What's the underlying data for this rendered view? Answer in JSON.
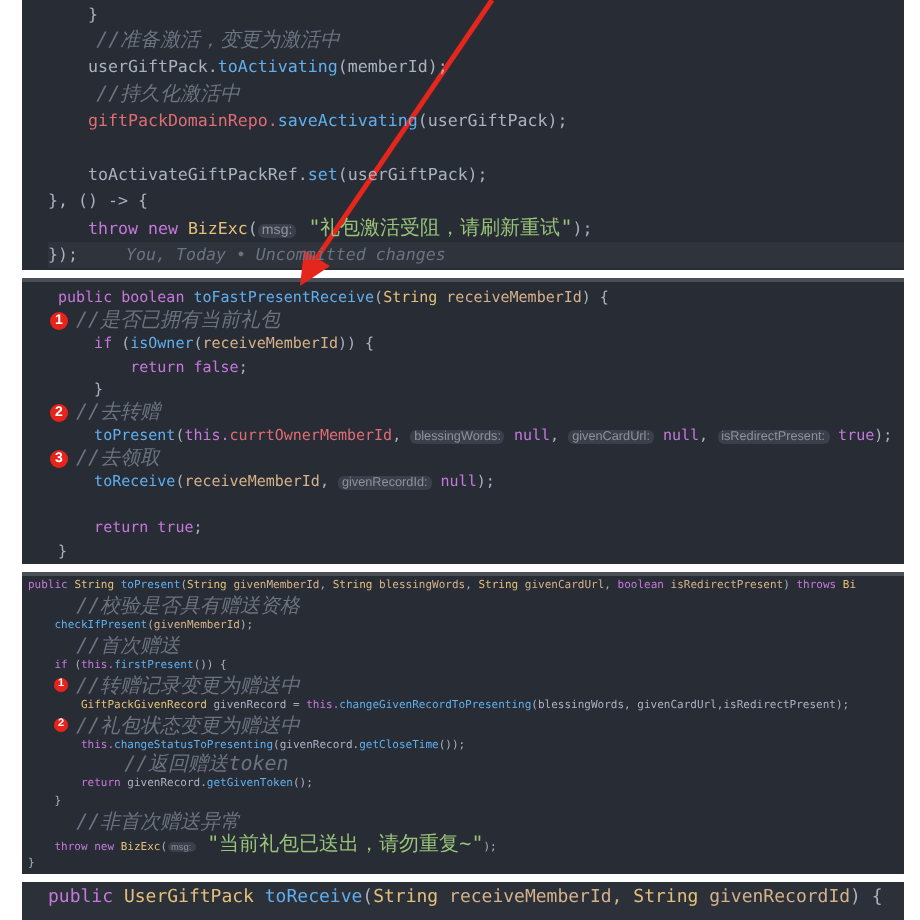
{
  "panels": [
    {
      "lines": [
        {
          "tokens": [
            {
              "kind": "plain",
              "text": "    }"
            }
          ]
        },
        {
          "tokens": [
            {
              "kind": "comment",
              "text": "    //准备激活，变更为激活中"
            }
          ]
        },
        {
          "tokens": [
            {
              "kind": "plain",
              "text": "    userGiftPack."
            },
            {
              "kind": "fn",
              "text": "toActivating"
            },
            {
              "kind": "plain",
              "text": "(memberId);"
            }
          ]
        },
        {
          "tokens": [
            {
              "kind": "comment",
              "text": "    //持久化激活中"
            }
          ]
        },
        {
          "tokens": [
            {
              "kind": "field",
              "text": "    giftPackDomainRepo."
            },
            {
              "kind": "fn",
              "text": "saveActivating"
            },
            {
              "kind": "plain",
              "text": "(userGiftPack);"
            }
          ]
        },
        {
          "space_before": true,
          "tokens": [
            {
              "kind": "plain",
              "text": "    toActivateGiftPackRef."
            },
            {
              "kind": "fn",
              "text": "set"
            },
            {
              "kind": "plain",
              "text": "(userGiftPack);"
            }
          ]
        },
        {
          "tokens": [
            {
              "kind": "plain",
              "text": "}, () -> {"
            }
          ]
        },
        {
          "tokens": [
            {
              "kind": "kw",
              "text": "    throw new "
            },
            {
              "kind": "type",
              "text": "BizExc"
            },
            {
              "kind": "plain",
              "text": "("
            },
            {
              "kind": "hint",
              "text": "msg:"
            },
            {
              "kind": "str",
              "text": " \"礼包激活受阻，请刷新重试\""
            },
            {
              "kind": "plain",
              "text": ");"
            }
          ]
        },
        {
          "current": true,
          "tokens": [
            {
              "kind": "plain",
              "text": "});"
            }
          ],
          "blame": "You, Today • Uncommitted changes"
        }
      ]
    },
    {
      "lines": [
        {
          "tokens": [
            {
              "kind": "kw",
              "text": "public boolean "
            },
            {
              "kind": "fn",
              "text": "toFastPresentReceive"
            },
            {
              "kind": "plain",
              "text": "("
            },
            {
              "kind": "type",
              "text": "String"
            },
            {
              "kind": "param",
              "text": " receiveMemberId"
            },
            {
              "kind": "plain",
              "text": ") {"
            }
          ]
        },
        {
          "badge": "1",
          "tokens": [
            {
              "kind": "comment",
              "text": "//是否已拥有当前礼包"
            }
          ]
        },
        {
          "tokens": [
            {
              "kind": "kw",
              "text": "    if "
            },
            {
              "kind": "plain",
              "text": "("
            },
            {
              "kind": "fn",
              "text": "isOwner"
            },
            {
              "kind": "plain",
              "text": "("
            },
            {
              "kind": "param",
              "text": "receiveMemberId"
            },
            {
              "kind": "plain",
              "text": ")) {"
            }
          ]
        },
        {
          "tokens": [
            {
              "kind": "kw",
              "text": "        return false"
            },
            {
              "kind": "plain",
              "text": ";"
            }
          ]
        },
        {
          "tokens": [
            {
              "kind": "plain",
              "text": "    }"
            }
          ]
        },
        {
          "badge": "2",
          "tokens": [
            {
              "kind": "comment",
              "text": "//去转赠"
            }
          ]
        },
        {
          "tokens": [
            {
              "kind": "fn",
              "text": "    toPresent"
            },
            {
              "kind": "plain",
              "text": "("
            },
            {
              "kind": "kw",
              "text": "this."
            },
            {
              "kind": "field",
              "text": "currtOwnerMemberId"
            },
            {
              "kind": "plain",
              "text": ", "
            },
            {
              "kind": "hint",
              "text": "blessingWords:"
            },
            {
              "kind": "kw",
              "text": " null"
            },
            {
              "kind": "plain",
              "text": ", "
            },
            {
              "kind": "hint",
              "text": "givenCardUrl:"
            },
            {
              "kind": "kw",
              "text": " null"
            },
            {
              "kind": "plain",
              "text": ", "
            },
            {
              "kind": "hint",
              "text": "isRedirectPresent:"
            },
            {
              "kind": "kw",
              "text": " true"
            },
            {
              "kind": "plain",
              "text": ");"
            }
          ]
        },
        {
          "badge": "3",
          "tokens": [
            {
              "kind": "comment",
              "text": "//去领取"
            }
          ]
        },
        {
          "tokens": [
            {
              "kind": "fn",
              "text": "    toReceive"
            },
            {
              "kind": "plain",
              "text": "("
            },
            {
              "kind": "param",
              "text": "receiveMemberId"
            },
            {
              "kind": "plain",
              "text": ", "
            },
            {
              "kind": "hint",
              "text": "givenRecordId:"
            },
            {
              "kind": "kw",
              "text": " null"
            },
            {
              "kind": "plain",
              "text": ");"
            }
          ]
        },
        {
          "space_before": true,
          "tokens": [
            {
              "kind": "kw",
              "text": "    return true"
            },
            {
              "kind": "plain",
              "text": ";"
            }
          ]
        },
        {
          "tokens": [
            {
              "kind": "plain",
              "text": "}"
            }
          ]
        }
      ]
    },
    {
      "lines": [
        {
          "tokens": [
            {
              "kind": "kw",
              "text": "public "
            },
            {
              "kind": "type",
              "text": "String "
            },
            {
              "kind": "fn",
              "text": "toPresent"
            },
            {
              "kind": "plain",
              "text": "("
            },
            {
              "kind": "type",
              "text": "String "
            },
            {
              "kind": "param",
              "text": "givenMemberId"
            },
            {
              "kind": "plain",
              "text": ", "
            },
            {
              "kind": "type",
              "text": "String "
            },
            {
              "kind": "param",
              "text": "blessingWords"
            },
            {
              "kind": "plain",
              "text": ", "
            },
            {
              "kind": "type",
              "text": "String "
            },
            {
              "kind": "param",
              "text": "givenCardUrl"
            },
            {
              "kind": "plain",
              "text": ", "
            },
            {
              "kind": "kw",
              "text": "boolean "
            },
            {
              "kind": "param",
              "text": "isRedirectPresent"
            },
            {
              "kind": "plain",
              "text": ") "
            },
            {
              "kind": "kw",
              "text": "throws "
            },
            {
              "kind": "type",
              "text": "Bi"
            }
          ]
        },
        {
          "tokens": [
            {
              "kind": "comment",
              "text": "    //校验是否具有赠送资格"
            }
          ]
        },
        {
          "tokens": [
            {
              "kind": "fn",
              "text": "    checkIfPresent"
            },
            {
              "kind": "plain",
              "text": "("
            },
            {
              "kind": "param",
              "text": "givenMemberId"
            },
            {
              "kind": "plain",
              "text": ");"
            }
          ]
        },
        {
          "tokens": [
            {
              "kind": "comment",
              "text": "    //首次赠送"
            }
          ]
        },
        {
          "tokens": [
            {
              "kind": "kw",
              "text": "    if "
            },
            {
              "kind": "plain",
              "text": "("
            },
            {
              "kind": "kw",
              "text": "this."
            },
            {
              "kind": "fn",
              "text": "firstPresent"
            },
            {
              "kind": "plain",
              "text": "()) {"
            }
          ]
        },
        {
          "badge": "1",
          "tokens": [
            {
              "kind": "comment",
              "text": "//转赠记录变更为赠送中"
            }
          ]
        },
        {
          "tokens": [
            {
              "kind": "type",
              "text": "        GiftPackGivenRecord "
            },
            {
              "kind": "plain",
              "text": "givenRecord = "
            },
            {
              "kind": "kw",
              "text": "this."
            },
            {
              "kind": "fn",
              "text": "changeGivenRecordToPresenting"
            },
            {
              "kind": "plain",
              "text": "(blessingWords, givenCardUrl,isRedirectPresent);"
            }
          ]
        },
        {
          "badge": "2",
          "tokens": [
            {
              "kind": "comment",
              "text": "//礼包状态变更为赠送中"
            }
          ]
        },
        {
          "tokens": [
            {
              "kind": "kw",
              "text": "        this."
            },
            {
              "kind": "fn",
              "text": "changeStatusToPresenting"
            },
            {
              "kind": "plain",
              "text": "(givenRecord."
            },
            {
              "kind": "fn",
              "text": "getCloseTime"
            },
            {
              "kind": "plain",
              "text": "());"
            }
          ]
        },
        {
          "tokens": [
            {
              "kind": "comment",
              "text": "        //返回赠送token"
            }
          ]
        },
        {
          "tokens": [
            {
              "kind": "kw",
              "text": "        return "
            },
            {
              "kind": "plain",
              "text": "givenRecord."
            },
            {
              "kind": "fn",
              "text": "getGivenToken"
            },
            {
              "kind": "plain",
              "text": "();"
            }
          ]
        },
        {
          "tokens": [
            {
              "kind": "plain",
              "text": "    }"
            }
          ]
        },
        {
          "tokens": [
            {
              "kind": "comment",
              "text": "    //非首次赠送异常"
            }
          ]
        },
        {
          "tokens": [
            {
              "kind": "kw",
              "text": "    throw new "
            },
            {
              "kind": "type",
              "text": "BizExc"
            },
            {
              "kind": "plain",
              "text": "("
            },
            {
              "kind": "hint",
              "text": "msg:"
            },
            {
              "kind": "str",
              "text": " \"当前礼包已送出，请勿重复~\""
            },
            {
              "kind": "plain",
              "text": ");"
            }
          ]
        },
        {
          "tokens": [
            {
              "kind": "plain",
              "text": "}"
            }
          ]
        }
      ]
    },
    {
      "lines": [
        {
          "tokens": [
            {
              "kind": "kw",
              "text": "public "
            },
            {
              "kind": "type",
              "text": "UserGiftPack "
            },
            {
              "kind": "fn",
              "text": "toReceive"
            },
            {
              "kind": "plain",
              "text": "("
            },
            {
              "kind": "type",
              "text": "String "
            },
            {
              "kind": "param",
              "text": "receiveMemberId, "
            },
            {
              "kind": "type",
              "text": "String "
            },
            {
              "kind": "param",
              "text": "givenRecordId"
            },
            {
              "kind": "plain",
              "text": ") {"
            }
          ]
        }
      ]
    }
  ]
}
